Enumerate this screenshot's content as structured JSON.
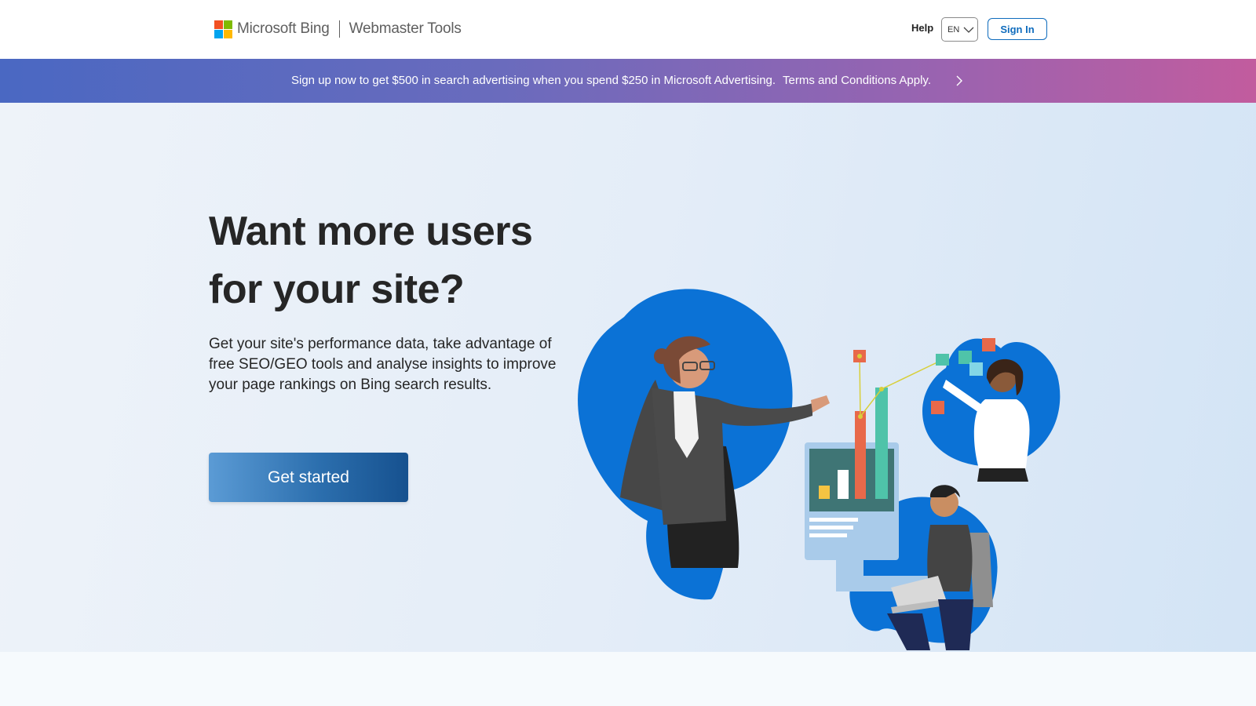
{
  "header": {
    "brand_name": "Microsoft Bing",
    "product_name": "Webmaster Tools",
    "help_label": "Help",
    "language": "EN",
    "signin_label": "Sign In"
  },
  "promo": {
    "text": "Sign up now to get $500 in search advertising when you spend $250 in Microsoft Advertising.",
    "terms": "Terms and Conditions Apply.",
    "chevron_icon": "chevron-right-icon"
  },
  "hero": {
    "title_line1": "Want more users",
    "title_line2": "for your site?",
    "description": "Get your site's performance data, take advantage of free SEO/GEO tools and analyse insights to improve your page rankings on Bing search results.",
    "cta_label": "Get started"
  },
  "colors": {
    "ms_red": "#f25022",
    "ms_green": "#7fba00",
    "ms_blue": "#00a4ef",
    "ms_yellow": "#ffb900",
    "accent": "#0f6cbd",
    "illustration_blue": "#0b72d6"
  }
}
